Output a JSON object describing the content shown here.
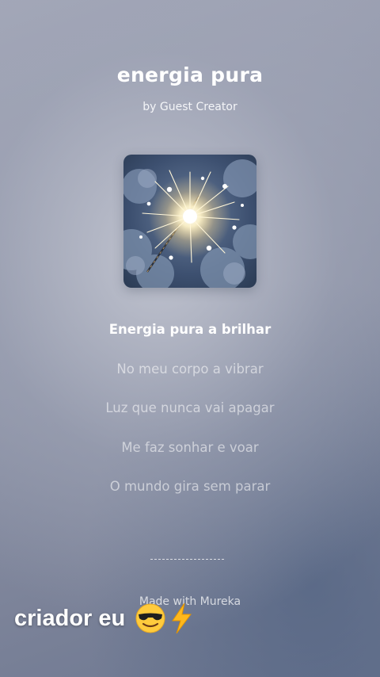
{
  "song": {
    "title": "energia pura",
    "author": "by Guest Creator"
  },
  "cover": {
    "icon": "sparkler-artwork",
    "colors": {
      "sky": "#34465f",
      "glow": "#fff3c8",
      "cloud": "#5a6f8c"
    }
  },
  "lyrics": {
    "active_index": 0,
    "lines": [
      "Energia pura a brilhar",
      "No meu corpo a vibrar",
      "Luz que nunca vai apagar",
      "Me faz sonhar e voar",
      "O mundo gira sem parar"
    ]
  },
  "divider": {
    "text": "------------"
  },
  "footer": {
    "text": "Made with Mureka"
  },
  "overlay": {
    "caption": "criador eu",
    "emoji_1": "smiling-face-with-sunglasses-icon",
    "emoji_2": "high-voltage-icon"
  }
}
